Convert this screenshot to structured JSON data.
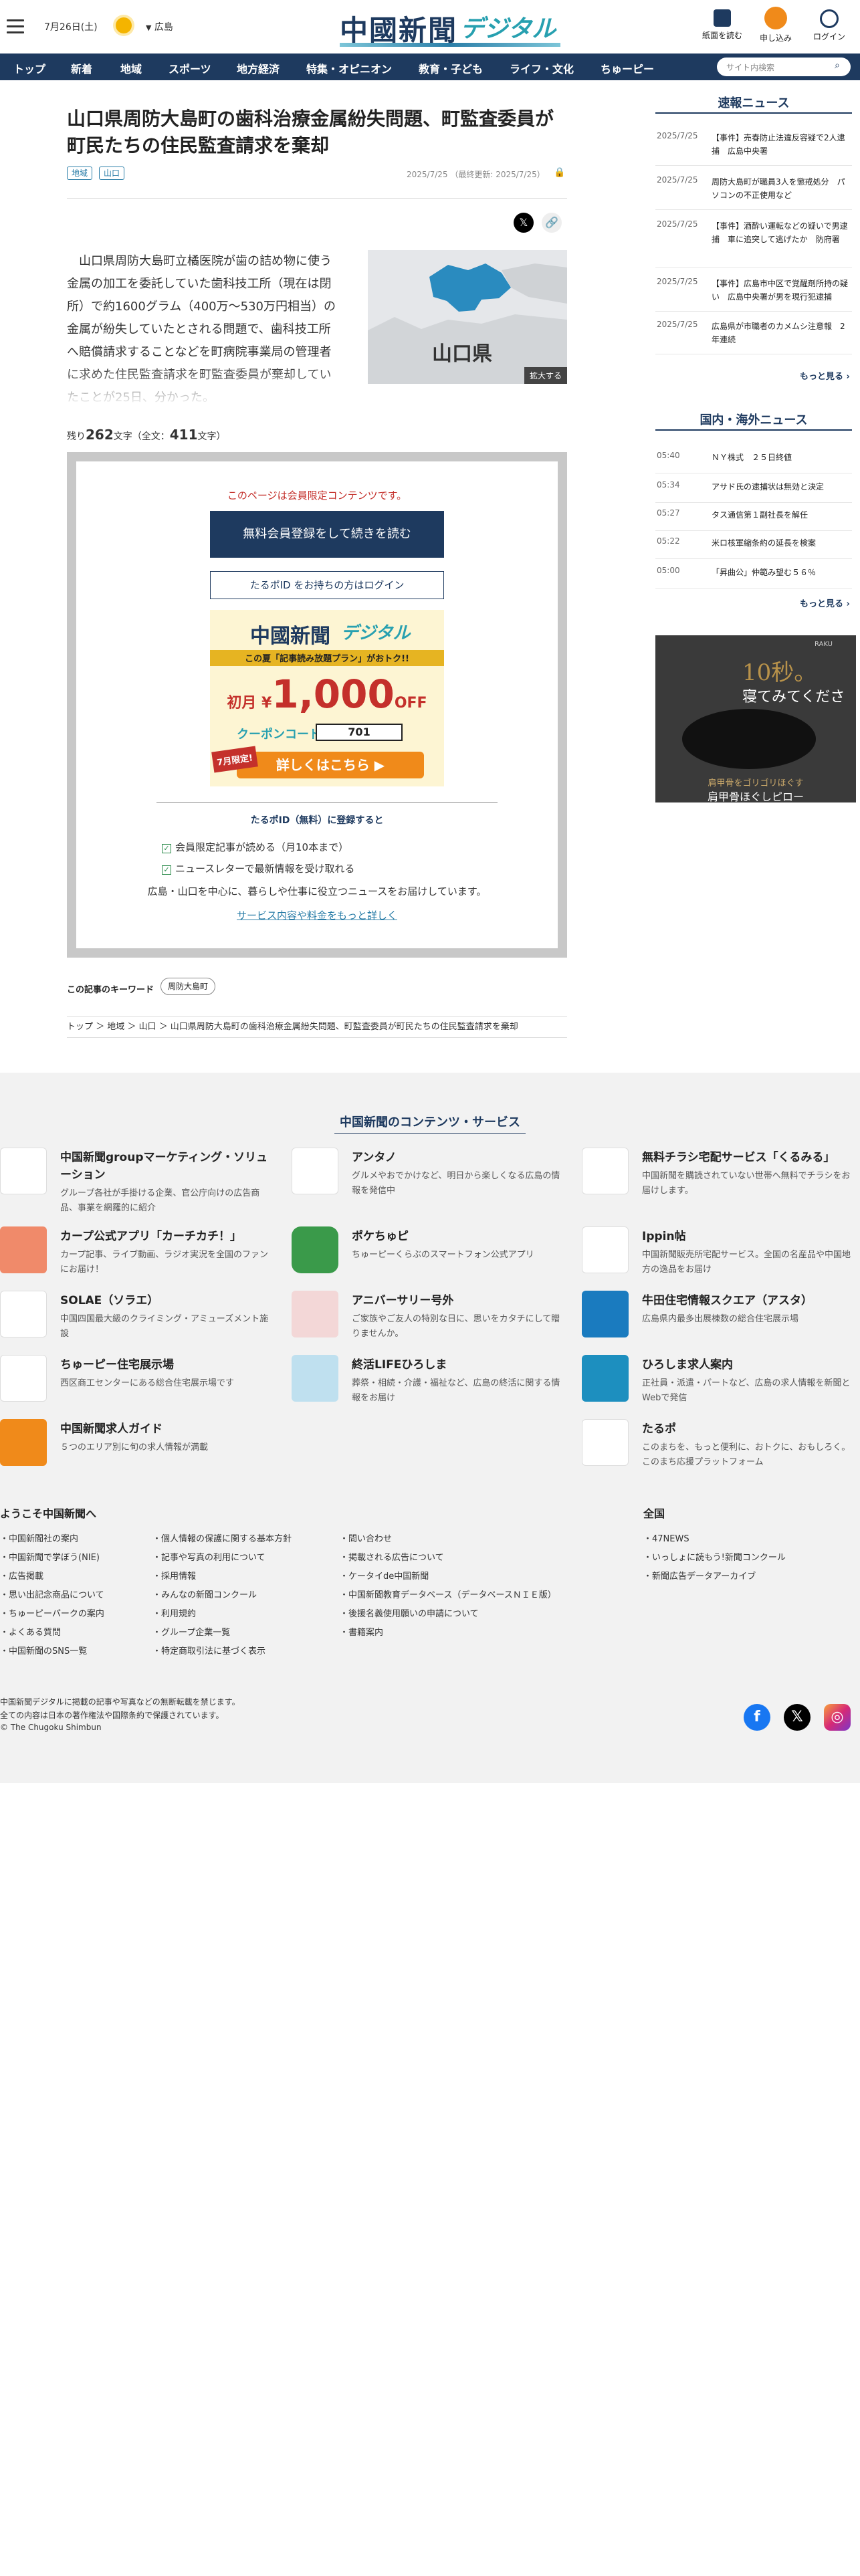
{
  "header": {
    "date": "7月26日(土)",
    "region": "広島",
    "logo_main": "中國新聞",
    "logo_sub": "デジタル",
    "buttons": [
      "紙面を読む",
      "申し込み",
      "ログイン"
    ],
    "search_placeholder": "サイト内検索"
  },
  "nav": [
    "トップ",
    "新着",
    "地域",
    "スポーツ",
    "地方経済",
    "特集・オピニオン",
    "教育・子ども",
    "ライフ・文化",
    "ちゅーピー"
  ],
  "article": {
    "title": "山口県周防大島町の歯科治療金属紛失問題、町監査委員が町民たちの住民監査請求を棄却",
    "tags": [
      "地域",
      "山口"
    ],
    "meta": "2025/7/25 （最終更新: 2025/7/25）",
    "body": "山口県周防大島町立橘医院が歯の詰め物に使う金属の加工を委託していた歯科技工所（現在は閉所）で約1600グラム（400万〜530万円相当）の金属が紛失していたとされる問題で、歯科技工所へ賠償請求することなどを町病院事業局の管理者に求めた住民監査請求を町監査委員が棄却していたことが25日、分かった。",
    "map_label": "山口県",
    "zoom_label": "拡大する",
    "remain_prefix": "残り",
    "remain_count": "262",
    "remain_mid": "文字（全文：",
    "total_count": "411",
    "remain_suffix": "文字）"
  },
  "paywall": {
    "lead": "このページは会員限定コンテンツです。",
    "register_button": "無料会員登録をして続きを読む",
    "login_button": "たるポID をお持ちの方はログイン",
    "promo": {
      "brand": "中國新聞",
      "brand_sub": "デジタル",
      "band": "この夏「記事読み放題プラン」がおトク!!",
      "price_prefix": "初月 ¥",
      "price": "1,000",
      "price_suffix": "OFF",
      "coupon_label": "クーポンコード",
      "coupon_code": "701",
      "badge": "7月限定!",
      "cta": "詳しくはこちら ▶"
    },
    "register_heading": "たるポID（無料）に登録すると",
    "benefits": [
      "会員限定記事が読める（月10本まで）",
      "ニュースレターで最新情報を受け取れる"
    ],
    "description": "広島・山口を中心に、暮らしや仕事に役立つニュースをお届けしています。",
    "more_link": "サービス内容や料金をもっと詳しく"
  },
  "keywords": {
    "label": "この記事のキーワード",
    "items": [
      "周防大島町"
    ]
  },
  "breadcrumb": "トップ ＞ 地域 ＞ 山口 ＞ 山口県周防大島町の歯科治療金属紛失問題、町監査委員が町民たちの住民監査請求を棄却",
  "sidebar": {
    "breaking": {
      "title": "速報ニュース",
      "items": [
        {
          "date": "2025/7/25",
          "text": "【事件】売春防止法違反容疑で2人逮捕　広島中央署"
        },
        {
          "date": "2025/7/25",
          "text": "周防大島町が職員3人を懲戒処分　パソコンの不正使用など"
        },
        {
          "date": "2025/7/25",
          "text": "【事件】酒酔い運転などの疑いで男逮捕　車に追突して逃げたか　防府署"
        },
        {
          "date": "2025/7/25",
          "text": "【事件】広島市中区で覚醒剤所持の疑い　広島中央署が男を現行犯逮捕"
        },
        {
          "date": "2025/7/25",
          "text": "広島県が市職者のカメムシ注意報　2年連続"
        }
      ],
      "more": "もっと見る ›"
    },
    "national": {
      "title": "国内・海外ニュース",
      "items": [
        {
          "date": "05:40",
          "text": "ＮＹ株式　２５日終値"
        },
        {
          "date": "05:34",
          "text": "アサド氏の逮捕状は無効と決定"
        },
        {
          "date": "05:27",
          "text": "タス通信第１副社長を解任"
        },
        {
          "date": "05:22",
          "text": "米ロ核軍縮条約の延長を検案"
        },
        {
          "date": "05:00",
          "text": "「昇曲公」仲範み望む５６％"
        }
      ],
      "more": "もっと見る ›"
    },
    "ad": {
      "brand": "RAKU",
      "big": "10秒。",
      "sub": "寝てみてください。",
      "small": "肩甲骨をゴリゴリほぐす",
      "product": "肩甲骨ほぐしピロー"
    }
  },
  "footer": {
    "heading": "中国新聞のコンテンツ・サービス",
    "services": [
      {
        "name": "中国新聞groupマーケティング・ソリューション",
        "desc": "グループ各社が手掛ける企業、官公庁向けの広告商品、事業を網羅的に紹介"
      },
      {
        "name": "アンタノ",
        "desc": "グルメやおでかけなど、明日から楽しくなる広島の情報を発信中"
      },
      {
        "name": "無料チラシ宅配サービス「くるみる」",
        "desc": "中国新聞を購読されていない世帯へ無料でチラシをお届けします。"
      },
      {
        "name": "カープ公式アプリ「カーチカチ！」",
        "desc": "カープ記事、ライブ動画、ラジオ実況を全国のファンにお届け！"
      },
      {
        "name": "ポケちゅピ",
        "desc": "ちゅーピーくらぶのスマートフォン公式アプリ"
      },
      {
        "name": "Ippin帖",
        "desc": "中国新聞販売所宅配サービス。全国の名産品や中国地方の逸品をお届け"
      },
      {
        "name": "SOLAE（ソラエ）",
        "desc": "中国四国最大級のクライミング・アミューズメント施設"
      },
      {
        "name": "アニバーサリー号外",
        "desc": "ご家族やご友人の特別な日に、思いをカタチにして贈りませんか。"
      },
      {
        "name": "牛田住宅情報スクエア（アスタ）",
        "desc": "広島県内最多出展棟数の総合住宅展示場"
      },
      {
        "name": "ちゅーピー住宅展示場",
        "desc": "西区商工センターにある総合住宅展示場です"
      },
      {
        "name": "終活LIFEひろしま",
        "desc": "葬祭・相続・介護・福祉など、広島の終活に関する情報をお届け"
      },
      {
        "name": "ひろしま求人案内",
        "desc": "正社員・派遣・パートなど、広島の求人情報を新聞とWebで発信"
      },
      {
        "name": "中国新聞求人ガイド",
        "desc": "５つのエリア別に旬の求人情報が満載"
      },
      {
        "name": "たるポ",
        "desc": "このまちを、もっと便利に、おトクに、おもしろく。このまち応援プラットフォーム"
      }
    ],
    "welcome": "ようこそ中国新聞へ",
    "national_heading": "全国",
    "col1": [
      "中国新聞社の案内",
      "中国新聞で学ぼう(NIE)",
      "広告掲載",
      "思い出記念商品について",
      "ちゅーピーパークの案内",
      "よくある質問",
      "中国新聞のSNS一覧"
    ],
    "col2": [
      "個人情報の保護に関する基本方針",
      "記事や写真の利用について",
      "採用情報",
      "みんなの新聞コンクール",
      "利用規約",
      "グループ企業一覧",
      "特定商取引法に基づく表示"
    ],
    "col3": [
      "問い合わせ",
      "掲載される広告について",
      "ケータイde中国新聞",
      "中国新聞教育データベース（データベースＮＩＥ版）",
      "後援名義使用願いの申請について",
      "書籍案内"
    ],
    "col4": [
      "47NEWS",
      "いっしょに読もう!新聞コンクール",
      "新聞広告データアーカイブ"
    ],
    "copy1": "中国新聞デジタルに掲載の記事や写真などの無断転載を禁じます。",
    "copy2": "全ての内容は日本の著作権法や国際条約で保護されています。",
    "copy3": "© The Chugoku Shimbun"
  },
  "colors": {
    "navy": "#1e3a5f",
    "teal": "#27a0b0",
    "red": "#c4302b",
    "orange": "#f08a1a"
  }
}
